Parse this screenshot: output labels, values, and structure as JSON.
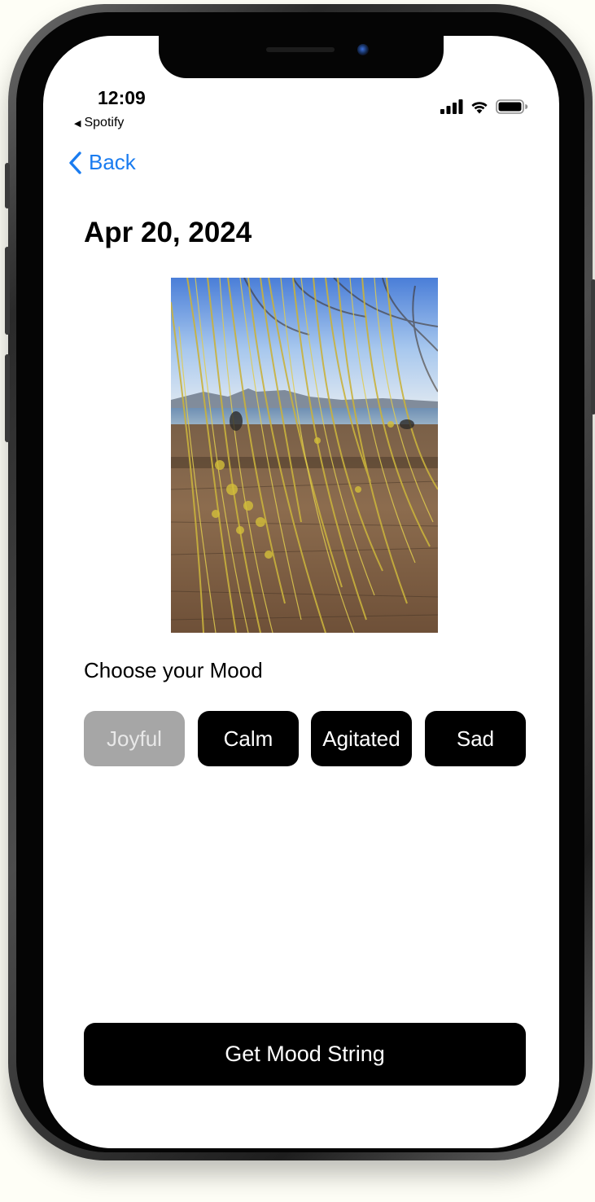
{
  "status_bar": {
    "time": "12:09",
    "back_to_app": "Spotify",
    "icons": [
      "cellular-signal-icon",
      "wifi-icon",
      "battery-icon"
    ]
  },
  "nav": {
    "back_label": "Back",
    "back_icon": "chevron-left-icon"
  },
  "entry": {
    "date_title": "Apr 20, 2024",
    "photo_subject": ""
  },
  "mood": {
    "label": "Choose your Mood",
    "options": [
      {
        "label": "Joyful",
        "selected": true
      },
      {
        "label": "Calm",
        "selected": false
      },
      {
        "label": "Agitated",
        "selected": false
      },
      {
        "label": "Sad",
        "selected": false
      }
    ]
  },
  "actions": {
    "primary_label": "Get Mood String"
  },
  "colors": {
    "accent": "#1a7cf0",
    "button_bg": "#000000",
    "button_selected_bg": "#a6a6a6",
    "text": "#000000"
  }
}
